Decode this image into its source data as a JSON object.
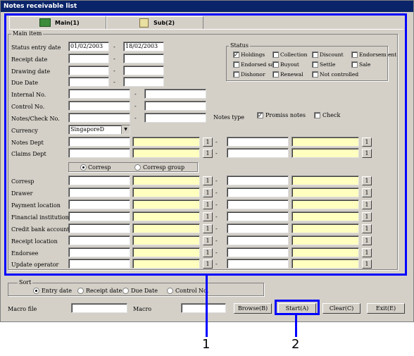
{
  "window": {
    "title": "Notes receivable list"
  },
  "tabs": [
    {
      "label": "Main(1)"
    },
    {
      "label": "Sub(2)"
    }
  ],
  "main_item": {
    "group_title": "Main item",
    "status_entry_date": {
      "label": "Status entry date",
      "from": "01/02/2003",
      "to": "18/02/2003"
    },
    "receipt_date": {
      "label": "Receipt date"
    },
    "drawing_date": {
      "label": "Drawing date"
    },
    "due_date": {
      "label": "Due Date"
    },
    "internal_no": {
      "label": "Internal No."
    },
    "control_no": {
      "label": "Control No."
    },
    "notes_check_no": {
      "label": "Notes/Check No."
    },
    "currency": {
      "label": "Currency",
      "value": "SingaporeD"
    },
    "notes_dept": {
      "label": "Notes Dept"
    },
    "claims_dept": {
      "label": "Claims Dept"
    },
    "notes_type": {
      "label": "Notes type",
      "promiss": "Promiss notes",
      "check": "Check"
    },
    "corresp_radio": {
      "corresp": "Corresp",
      "corresp_group": "Corresp group"
    },
    "fields": [
      {
        "label": "Corresp"
      },
      {
        "label": "Drawer"
      },
      {
        "label": "Payment location"
      },
      {
        "label": "Financial institution"
      },
      {
        "label": "Credit bank account"
      },
      {
        "label": "Receipt location"
      },
      {
        "label": "Endorsee"
      },
      {
        "label": "Update operator"
      }
    ],
    "btn_1": "1",
    "dash": "-"
  },
  "status": {
    "title": "Status",
    "items": [
      "Holdings",
      "Collection",
      "Discount",
      "Endorsem ent",
      "Endorsed sale",
      "Buyout",
      "Settle",
      "Sale",
      "Dishonor",
      "Renewal",
      "Not controlled"
    ]
  },
  "sort": {
    "title": "Sort",
    "options": [
      "Entry date",
      "Receipt date",
      "Due Date",
      "Control No."
    ]
  },
  "bottom": {
    "macro_file": "Macro file",
    "macro": "Macro",
    "browse": "Browse(B)",
    "start": "Start(A)",
    "clear": "Clear(C)",
    "exit": "Exit(E)"
  },
  "callouts": [
    "1",
    "2"
  ],
  "colors": {
    "highlight": "#0000ff",
    "title_bg": "#0a246a",
    "yellow_field": "#ffffc0"
  }
}
